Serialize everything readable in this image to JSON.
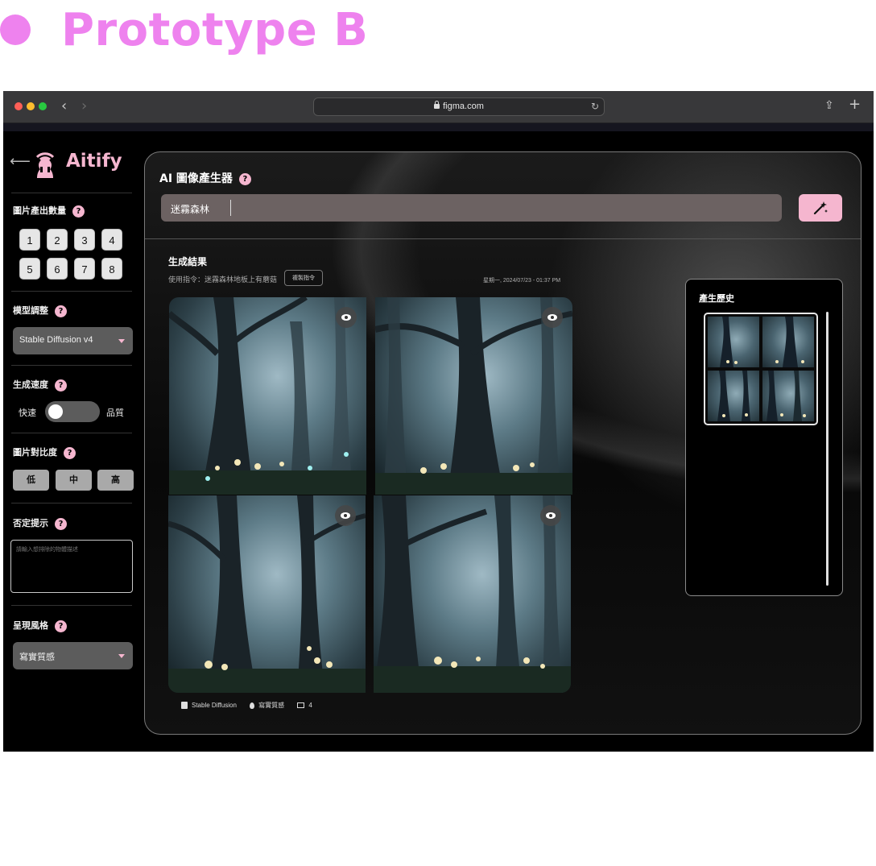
{
  "heading": {
    "title": "Prototype B"
  },
  "browser": {
    "url": "figma.com"
  },
  "sidebar": {
    "logo": "Aitify",
    "count_label": "圖片產出數量",
    "count_options": [
      "1",
      "2",
      "3",
      "4",
      "5",
      "6",
      "7",
      "8"
    ],
    "model_label": "模型調整",
    "model_value": "Stable Diffusion v4",
    "speed_label": "生成速度",
    "speed_fast": "快速",
    "speed_quality": "品質",
    "speed_toggle_on": false,
    "contrast_label": "圖片對比度",
    "contrast_options": [
      "低",
      "中",
      "高"
    ],
    "negative_label": "否定提示",
    "negative_placeholder": "請輸入想排除的物體描述",
    "style_label": "呈現風格",
    "style_value": "寫實質感",
    "help": "?"
  },
  "main": {
    "title": "AI 圖像產生器",
    "prompt_value": "迷霧森林",
    "results_title": "生成結果",
    "used_command": "使用指令：迷霧森林地板上有蘑菇",
    "copy_button": "複製指令",
    "timestamp": "星期一, 2024/07/23 - 01:37 PM",
    "meta": {
      "model": "Stable Diffusion",
      "style": "寫實質感",
      "count": "4"
    },
    "history_title": "產生歷史"
  },
  "colors": {
    "accent": "#f5b6cf",
    "heading": "#ee82ee"
  },
  "icons": [
    "back-arrow-icon",
    "help-icon",
    "caret-down-icon",
    "magic-wand-icon",
    "eye-icon",
    "lock-icon",
    "reload-icon",
    "share-icon",
    "plus-icon"
  ]
}
